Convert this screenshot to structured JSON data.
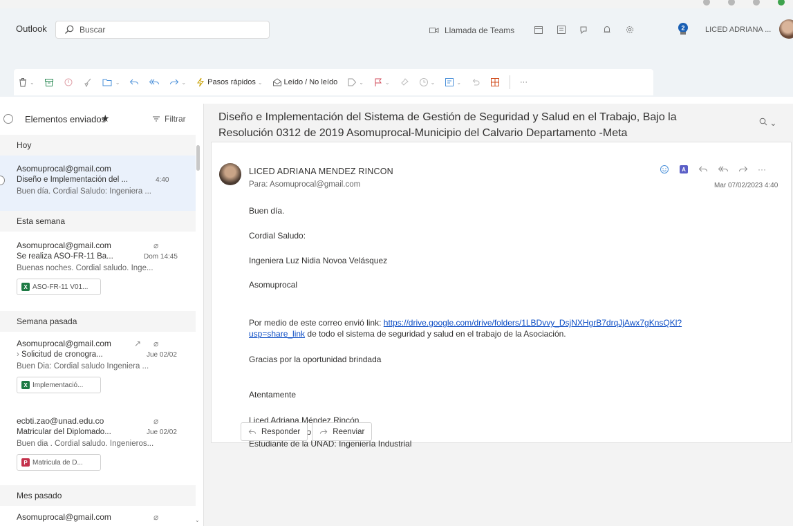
{
  "topbar": {
    "brand": "Outlook",
    "search_placeholder": "Buscar",
    "teams_call_label": "Llamada de Teams",
    "user_name": "LICED ADRIANA ...",
    "notification_count": "2"
  },
  "toolbar": {
    "quick_steps": "Pasos rápidos",
    "read_unread": "Leído / No leído",
    "more": "···"
  },
  "folder": {
    "title": "Elementos enviados",
    "filter_label": "Filtrar",
    "groups": [
      "Hoy",
      "Esta semana",
      "Semana pasada",
      "Mes pasado"
    ],
    "messages": [
      {
        "from": "Asomuprocal@gmail.com",
        "subject": "Diseño e Implementación del ...",
        "date": "4:40",
        "preview": "Buen día. Cordial Saludo: Ingeniera ..."
      },
      {
        "from": "Asomuprocal@gmail.com",
        "subject": "Se realiza ASO-FR-11 Ba...",
        "date": "Dom 14:45",
        "preview": "Buenas noches. Cordial saludo. Inge...",
        "attachment": "ASO-FR-11 V01..."
      },
      {
        "from": "Asomuprocal@gmail.com",
        "subject": "Solicitud de cronogra...",
        "date": "Jue 02/02",
        "preview": "Buen Dia: Cordial saludo Ingeniera ...",
        "attachment": "Implementació..."
      },
      {
        "from": "ecbti.zao@unad.edu.co",
        "subject": "Matricular del Diplomado...",
        "date": "Jue 02/02",
        "preview": "Buen dia . Cordial saludo. Ingenieros...",
        "attachment": "Matricula de D..."
      },
      {
        "from": "Asomuprocal@gmail.com"
      }
    ]
  },
  "reading": {
    "subject_line1": "Diseño e Implementación del Sistema de Gestión de Seguridad y Salud en el Trabajo, Bajo la",
    "subject_line2": "Resolución 0312 de 2019 Asomuprocal-Municipio del Calvario Departamento -Meta",
    "sender": "LICED ADRIANA MENDEZ RINCON",
    "to": "Para:  Asomuprocal@gmail.com",
    "date": "Mar 07/02/2023 4:40",
    "body": {
      "greeting": "Buen día.",
      "salute": "Cordial Saludo:",
      "recipient_name": "Ingeniera Luz Nidia Novoa Velásquez",
      "org": "Asomuprocal",
      "link_intro": "Por medio de este correo envió link: ",
      "link_1": "https://drive.google.com/drive/folders/1LBDvvy_DsjNXHgrB7drqJjAwx7gKnsQKl?",
      "link_2": "usp=share_link",
      "link_outro": "  de todo el sistema de seguridad y salud en el trabajo de la Asociación.",
      "thanks": "Gracias por la oportunidad brindada",
      "closing": "Atentamente",
      "sig_name": "Liced Adriana Méndez Rincón",
      "sig_id": "40.340.645 V/cio",
      "sig_role": "Estudiante de la UNAD: Ingeniería Industrial"
    },
    "reply_label": "Responder",
    "forward_label": "Reenviar"
  },
  "colors": {
    "accent": "#0f6cbd",
    "link": "#0b4cc4",
    "header_bg": "#eff3f6",
    "selected_bg": "#eaf1fb",
    "excel_green": "#1d7a44",
    "pdf_red": "#c4314b"
  }
}
